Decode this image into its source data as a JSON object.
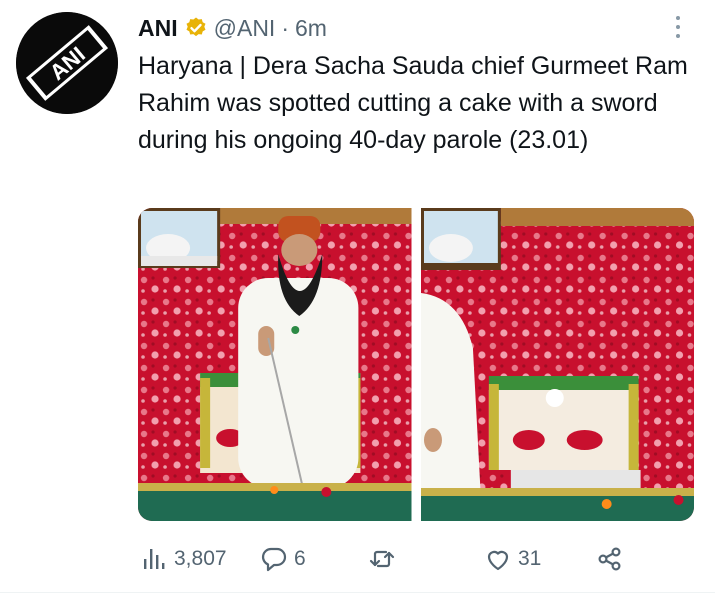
{
  "author": {
    "name": "ANI",
    "handle": "@ANI",
    "separator": "·",
    "time": "6m",
    "avatar_text": "ANI",
    "verified_color": "#e8b308"
  },
  "tweet": {
    "text": "Haryana | Dera Sacha Sauda chief Gurmeet Ram Rahim was spotted cutting a cake with a sword during his ongoing 40-day parole (23.01)"
  },
  "media": {
    "photos": [
      {
        "id": "photo-1"
      },
      {
        "id": "photo-2"
      }
    ]
  },
  "actions": {
    "views": "3,807",
    "replies": "6",
    "retweets": "",
    "likes": "31"
  },
  "colors": {
    "text": "#0f1419",
    "secondary": "#536471",
    "backdrop_red": "#c8102e"
  },
  "icons": [
    "verified-badge-icon",
    "more-options-icon",
    "views-icon",
    "reply-icon",
    "retweet-icon",
    "like-icon",
    "share-icon"
  ]
}
